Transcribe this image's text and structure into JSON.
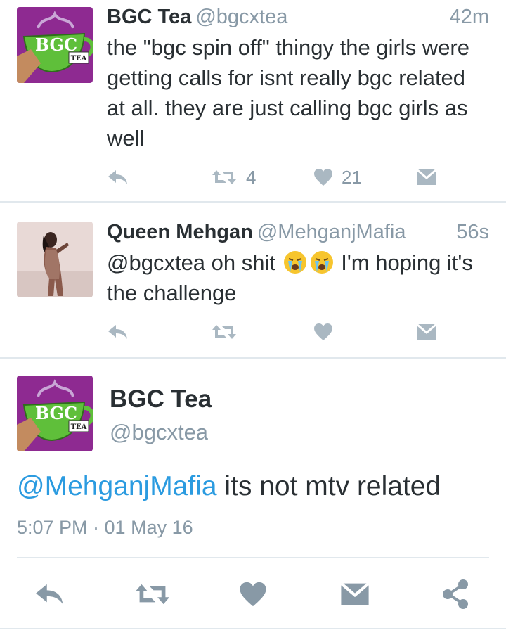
{
  "tweets": [
    {
      "name": "BGC Tea",
      "handle": "@bgcxtea",
      "time": "42m",
      "text": "the \"bgc spin off\" thingy the girls were getting calls for isnt really bgc related at all. they are just calling bgc girls as well",
      "retweets": "4",
      "likes": "21"
    },
    {
      "name": "Queen Mehgan",
      "handle": "@MehganjMafia",
      "time": "56s",
      "text_before": "@bgcxtea oh shit",
      "text_after": "I'm hoping it's the challenge",
      "emoji": [
        "loudly-crying-face",
        "loudly-crying-face"
      ]
    }
  ],
  "focused": {
    "name": "BGC Tea",
    "handle": "@bgcxtea",
    "mention": "@MehganjMafia",
    "text": " its not mtv related",
    "timestamp": "5:07 PM · 01 May 16"
  },
  "icons": [
    "reply-icon",
    "retweet-icon",
    "like-icon",
    "direct-message-icon",
    "share-icon"
  ],
  "colors": {
    "link": "#2b9be0",
    "secondary": "#8899a6",
    "icon_light": "#aab8c2",
    "divider": "#e1e8ed",
    "bgc_purple": "#8e2a91",
    "bgc_green": "#5fbf3a"
  }
}
